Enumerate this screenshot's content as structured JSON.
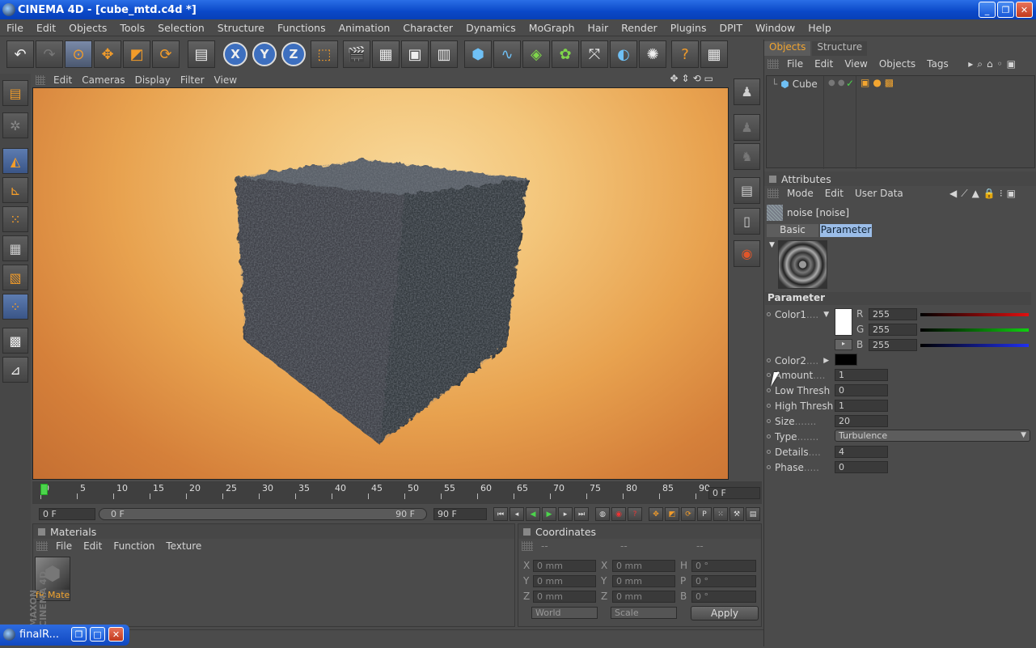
{
  "window": {
    "title": "CINEMA 4D - [cube_mtd.c4d *]"
  },
  "menu": [
    "File",
    "Edit",
    "Objects",
    "Tools",
    "Selection",
    "Structure",
    "Functions",
    "Animation",
    "Character",
    "Dynamics",
    "MoGraph",
    "Hair",
    "Render",
    "Plugins",
    "DPIT",
    "Window",
    "Help"
  ],
  "viewport": {
    "menu": [
      "Edit",
      "Cameras",
      "Display",
      "Filter",
      "View"
    ]
  },
  "timeline": {
    "ticks": [
      "0",
      "5",
      "10",
      "15",
      "20",
      "25",
      "30",
      "35",
      "40",
      "45",
      "50",
      "55",
      "60",
      "65",
      "70",
      "75",
      "80",
      "85",
      "90"
    ],
    "current_frame": "0 F",
    "start_field": "0 F",
    "slider_start": "0 F",
    "slider_end": "90 F",
    "end_field": "90 F"
  },
  "materials": {
    "title": "Materials",
    "menu": [
      "File",
      "Edit",
      "Function",
      "Texture"
    ],
    "item_label": "fR Mate"
  },
  "coordinates": {
    "title": "Coordinates",
    "headers": [
      "--",
      "--",
      "--"
    ],
    "rows": [
      {
        "a": "X",
        "av": "0 mm",
        "b": "X",
        "bv": "0 mm",
        "c": "H",
        "cv": "0 °"
      },
      {
        "a": "Y",
        "av": "0 mm",
        "b": "Y",
        "bv": "0 mm",
        "c": "P",
        "cv": "0 °"
      },
      {
        "a": "Z",
        "av": "0 mm",
        "b": "Z",
        "bv": "0 mm",
        "c": "B",
        "cv": "0 °"
      }
    ],
    "world": "World",
    "scale": "Scale",
    "apply": "Apply"
  },
  "objects": {
    "tabs": [
      "Objects",
      "Structure"
    ],
    "menu": [
      "File",
      "Edit",
      "View",
      "Objects",
      "Tags"
    ],
    "item": "Cube"
  },
  "attributes": {
    "title": "Attributes",
    "menu": [
      "Mode",
      "Edit",
      "User Data"
    ],
    "shader_name": "noise [noise]",
    "tabs": [
      "Basic",
      "Parameter"
    ],
    "section": "Parameter",
    "color1": {
      "label": "Color1",
      "r": "255",
      "g": "255",
      "b": "255",
      "rl": "R",
      "gl": "G",
      "bl": "B"
    },
    "params": [
      {
        "label": "Color2"
      },
      {
        "label": "Amount",
        "value": "1"
      },
      {
        "label": "Low Thresh",
        "value": "0"
      },
      {
        "label": "High Thresh",
        "value": "1"
      },
      {
        "label": "Size",
        "value": "20"
      },
      {
        "label": "Type",
        "value": "Turbulence"
      },
      {
        "label": "Details",
        "value": "4"
      },
      {
        "label": "Phase",
        "value": "0"
      }
    ]
  },
  "taskbar": {
    "label": "finalR..."
  },
  "brand": "MAXON CINEMA 4D"
}
